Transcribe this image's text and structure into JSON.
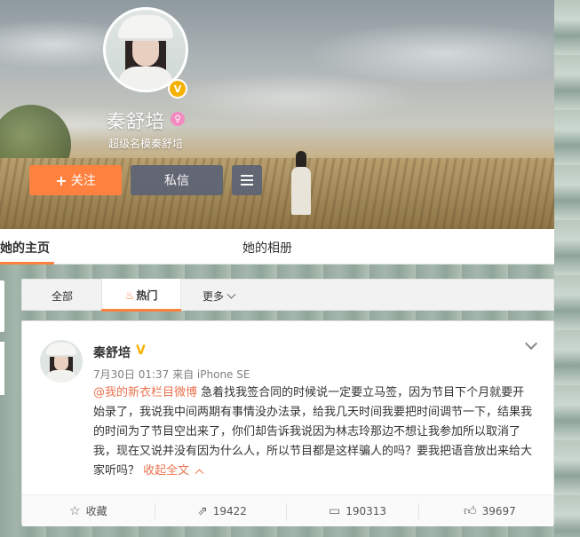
{
  "profile": {
    "name": "秦舒培",
    "bio": "超级名模秦舒培",
    "follow_label": "关注",
    "message_label": "私信",
    "verified_badge": "V",
    "gender_icon": "female-icon"
  },
  "tabs": {
    "home_label": "她的主页",
    "album_label": "她的相册"
  },
  "filters": {
    "all_label": "全部",
    "hot_label": "热门",
    "more_label": "更多"
  },
  "post": {
    "author": "秦舒培",
    "meta": "7月30日 01:37 来自 iPhone SE",
    "mention": "@我的新衣栏目微博",
    "body": " 急着找我签合同的时候说一定要立马签，因为节目下个月就要开始录了，我说我中间两期有事情没办法录，给我几天时间我要把时间调节一下，结果我的时间为了节目空出来了，你们却告诉我说因为林志玲那边不想让我参加所以取消了我，现在又说并没有因为什么人，所以节目都是这样骗人的吗？要我把语音放出来给大家听吗？",
    "collapse_label": "收起全文",
    "actions": {
      "favorite_label": "收藏",
      "repost_count": "19422",
      "comment_count": "190313",
      "like_count": "39697"
    }
  },
  "colors": {
    "accent": "#ff8140",
    "link": "#eb7350",
    "verified": "#f5b100"
  }
}
